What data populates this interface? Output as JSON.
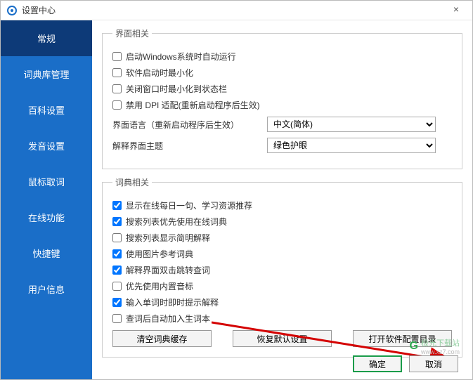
{
  "window": {
    "title": "设置中心",
    "close": "×"
  },
  "sidebar": {
    "items": [
      {
        "label": "常规",
        "active": true
      },
      {
        "label": "词典库管理"
      },
      {
        "label": "百科设置"
      },
      {
        "label": "发音设置"
      },
      {
        "label": "鼠标取词"
      },
      {
        "label": "在线功能"
      },
      {
        "label": "快捷键"
      },
      {
        "label": "用户信息"
      }
    ]
  },
  "group1": {
    "legend": "界面相关",
    "checks": [
      {
        "label": "启动Windows系统时自动运行",
        "checked": false
      },
      {
        "label": "软件启动时最小化",
        "checked": false
      },
      {
        "label": "关闭窗口时最小化到状态栏",
        "checked": false
      },
      {
        "label": "禁用 DPI 适配(重新启动程序后生效)",
        "checked": false
      }
    ],
    "lang_label": "界面语言（重新启动程序后生效）",
    "lang_value": "中文(简体)",
    "theme_label": "解释界面主题",
    "theme_value": "绿色护眼"
  },
  "group2": {
    "legend": "词典相关",
    "checks": [
      {
        "label": "显示在线每日一句、学习资源推荐",
        "checked": true
      },
      {
        "label": "搜索列表优先使用在线词典",
        "checked": true
      },
      {
        "label": "搜索列表显示简明解释",
        "checked": false
      },
      {
        "label": "使用图片参考词典",
        "checked": true
      },
      {
        "label": "解释界面双击跳转查词",
        "checked": true
      },
      {
        "label": "优先使用内置音标",
        "checked": false
      },
      {
        "label": "输入单词时即时提示解释",
        "checked": true
      },
      {
        "label": "查词后自动加入生词本",
        "checked": false
      }
    ],
    "buttons": [
      "清空词典缓存",
      "恢复默认设置",
      "打开软件配置目录"
    ]
  },
  "footer": {
    "ok": "确定",
    "cancel": "取消"
  },
  "watermark": {
    "text": "极光下载站",
    "url": "www.xz7.com"
  }
}
